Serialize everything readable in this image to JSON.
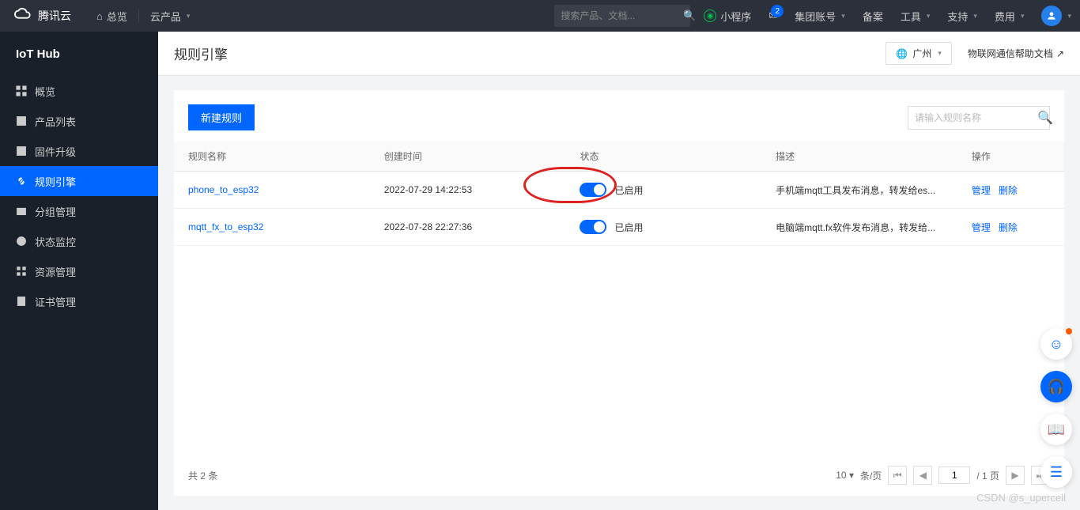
{
  "topnav": {
    "brand": "腾讯云",
    "overview": "总览",
    "products": "云产品",
    "search_placeholder": "搜索产品、文档...",
    "miniapp": "小程序",
    "mail_badge": "2",
    "group": "集团账号",
    "beian": "备案",
    "tools": "工具",
    "support": "支持",
    "cost": "费用"
  },
  "sidebar": {
    "title": "IoT Hub",
    "items": [
      {
        "label": "概览"
      },
      {
        "label": "产品列表"
      },
      {
        "label": "固件升级"
      },
      {
        "label": "规则引擎"
      },
      {
        "label": "分组管理"
      },
      {
        "label": "状态监控"
      },
      {
        "label": "资源管理"
      },
      {
        "label": "证书管理"
      }
    ]
  },
  "header": {
    "title": "规则引擎",
    "region": "广州",
    "help_link": "物联网通信帮助文档"
  },
  "toolbar": {
    "new_rule": "新建规则",
    "search_placeholder": "请输入规则名称"
  },
  "table": {
    "cols": {
      "name": "规则名称",
      "time": "创建时间",
      "status": "状态",
      "desc": "描述",
      "ops": "操作"
    },
    "status_enabled": "已启用",
    "op_manage": "管理",
    "op_delete": "删除",
    "rows": [
      {
        "name": "phone_to_esp32",
        "time": "2022-07-29 14:22:53",
        "desc": "手机端mqtt工具发布消息，转发给es..."
      },
      {
        "name": "mqtt_fx_to_esp32",
        "time": "2022-07-28 22:27:36",
        "desc": "电脑端mqtt.fx软件发布消息，转发给..."
      }
    ]
  },
  "footer": {
    "total_prefix": "共 ",
    "total_count": "2",
    "total_suffix": " 条",
    "page_size": "10",
    "page_size_label": "条/页",
    "page": "1",
    "page_of": "/ 1 页"
  },
  "watermark": "CSDN @s_upercell"
}
